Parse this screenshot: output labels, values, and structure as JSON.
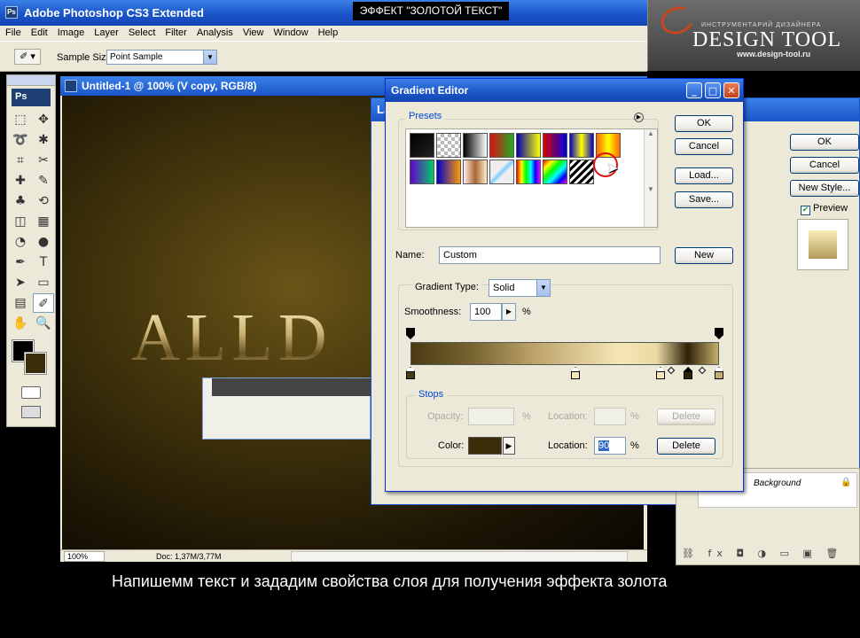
{
  "app": {
    "title": "Adobe Photoshop CS3 Extended",
    "badge": "Ps"
  },
  "banner": "ЭФФЕКТ \"ЗОЛОТОЙ ТЕКСТ\"",
  "logo": {
    "tagline": "ИНСТРУМЕНТАРИЙ ДИЗАЙНЕРА",
    "brand": "DESIGN TOOL",
    "site": "www.design-tool.ru"
  },
  "menu": [
    "File",
    "Edit",
    "Image",
    "Layer",
    "Select",
    "Filter",
    "Analysis",
    "View",
    "Window",
    "Help"
  ],
  "options": {
    "label": "Sample Size:",
    "value": "Point Sample"
  },
  "tools": {
    "logo": "Ps",
    "items": [
      "marquee-icon",
      "move-icon",
      "lasso-icon",
      "magic-wand-icon",
      "crop-icon",
      "slice-icon",
      "healing-icon",
      "brush-icon",
      "stamp-icon",
      "history-brush-icon",
      "eraser-icon",
      "gradient-icon",
      "blur-icon",
      "dodge-icon",
      "pen-icon",
      "type-icon",
      "path-select-icon",
      "shape-icon",
      "notes-icon",
      "eyedropper-icon",
      "hand-icon",
      "zoom-icon"
    ],
    "glyphs": [
      "⬚",
      "✥",
      "➰",
      "✱",
      "⌗",
      "✂",
      "✚",
      "✎",
      "♣",
      "⟲",
      "◫",
      "▦",
      "◔",
      "●",
      "✒",
      "T",
      "➤",
      "▭",
      "▤",
      "✐",
      "✋",
      "🔍"
    ],
    "foreground": "#000000",
    "background": "#3c2d0a"
  },
  "document": {
    "title": "Untitled-1 @ 100% (V copy, RGB/8)",
    "text": "ALLD",
    "zoom": "100%",
    "doc_info": "Doc: 1,37M/3,77M"
  },
  "layer_style": {
    "title_partial": "La",
    "ok": "OK",
    "cancel": "Cancel",
    "new_style": "New Style...",
    "preview": "Preview"
  },
  "layers_panel": {
    "layer_name": "Background"
  },
  "gradient_editor": {
    "title": "Gradient Editor",
    "presets_label": "Presets",
    "buttons": {
      "ok": "OK",
      "cancel": "Cancel",
      "load": "Load...",
      "save": "Save...",
      "new": "New",
      "delete_opacity": "Delete",
      "delete_color": "Delete"
    },
    "name_label": "Name:",
    "name_value": "Custom",
    "gradient_type_label": "Gradient Type:",
    "gradient_type_value": "Solid",
    "smoothness_label": "Smoothness:",
    "smoothness_value": "100",
    "percent": "%",
    "stops_label": "Stops",
    "opacity_label": "Opacity:",
    "location_label": "Location:",
    "color_label": "Color:",
    "color_location_value": "90",
    "stop_color": "#3c2d0a",
    "gradient_colors": [
      "#4a3a12",
      "#7d6a35",
      "#bca36a",
      "#f5e7b6",
      "#ead9a2",
      "#2e2208",
      "#c5ae6a"
    ]
  },
  "subtitle": "Напишемм текст и зададим свойства слоя для получения эффекта золота"
}
